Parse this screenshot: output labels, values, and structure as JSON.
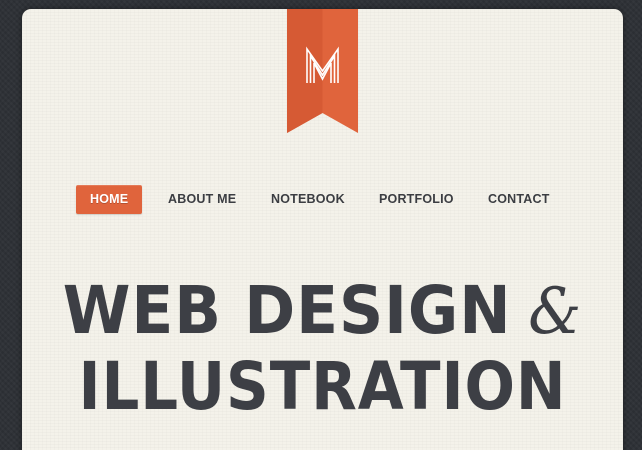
{
  "brand": {
    "logo_letter": "M",
    "ribbon_color": "#e0643c"
  },
  "nav": {
    "items": [
      {
        "label": "HOME",
        "active": true
      },
      {
        "label": "ABOUT ME",
        "active": false
      },
      {
        "label": "NOTEBOOK",
        "active": false
      },
      {
        "label": "PORTFOLIO",
        "active": false
      },
      {
        "label": "CONTACT",
        "active": false
      }
    ]
  },
  "hero": {
    "line1": "WEB DESIGN",
    "ampersand": "&",
    "line2": "ILLUSTRATION"
  },
  "colors": {
    "background": "#2f3237",
    "card": "#f4f2ea",
    "accent": "#e0643c",
    "text": "#3d3f45"
  }
}
